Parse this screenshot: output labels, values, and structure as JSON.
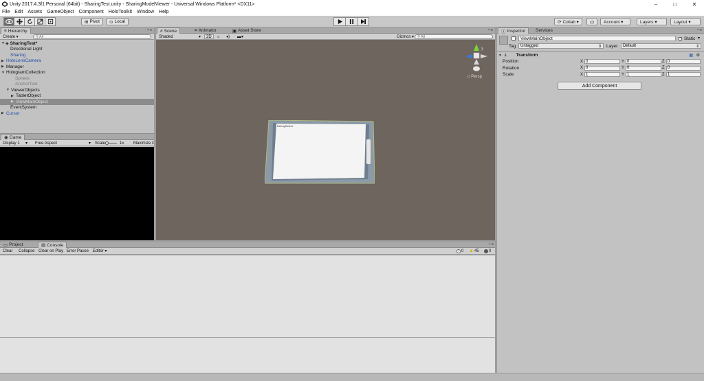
{
  "window": {
    "title": "Unity 2017.4.3f1 Personal (64bit) - SharingTest.unity - SharingModelViewer - Universal Windows Platform* <DX11>",
    "minimize": "–",
    "maximize": "□",
    "close": "✕"
  },
  "menu": [
    "File",
    "Edit",
    "Assets",
    "GameObject",
    "Component",
    "HoloToolkit",
    "Window",
    "Help"
  ],
  "toolbar": {
    "pivot": "Pivot",
    "local": "Local",
    "collab": "Collab ▾",
    "account": "Account ▾",
    "layers": "Layers ▾",
    "layout": "Layout ▾"
  },
  "hierarchy": {
    "tab": "Hierarchy",
    "create": "Create ▾",
    "search_placeholder": "All",
    "scene_name": "SharingTest*",
    "items": [
      {
        "label": "Directional Light",
        "indent": 1,
        "arrow": "",
        "style": ""
      },
      {
        "label": "Sharing",
        "indent": 1,
        "arrow": "",
        "style": "prefab"
      },
      {
        "label": "HoloLensCamera",
        "indent": 1,
        "arrow": "▶",
        "style": "prefab"
      },
      {
        "label": "Manager",
        "indent": 1,
        "arrow": "▶",
        "style": ""
      },
      {
        "label": "HologramCollection",
        "indent": 1,
        "arrow": "▼",
        "style": ""
      },
      {
        "label": "Sphere",
        "indent": 2,
        "arrow": "",
        "style": "inactive"
      },
      {
        "label": "AnchorText",
        "indent": 2,
        "arrow": "",
        "style": "inactive"
      },
      {
        "label": "ViewerObjects",
        "indent": 2,
        "arrow": "▼",
        "style": ""
      },
      {
        "label": "TabletObject",
        "indent": 3,
        "arrow": "▶",
        "style": ""
      },
      {
        "label": "ViewMainObject",
        "indent": 3,
        "arrow": "▶",
        "style": "selected"
      },
      {
        "label": "EventSystem",
        "indent": 1,
        "arrow": "",
        "style": ""
      },
      {
        "label": "Cursor",
        "indent": 1,
        "arrow": "▶",
        "style": "prefab"
      }
    ]
  },
  "scene": {
    "tabs": [
      "Scene",
      "Animator",
      "Asset Store"
    ],
    "shading": "Shaded",
    "mode_2d": "2D",
    "gizmos": "Gizmos ▾",
    "search_placeholder": "All",
    "persp": "◁ Persp",
    "tablet_text": "DebugSelect"
  },
  "game": {
    "tab": "Game",
    "display": "Display 1",
    "aspect": "Free Aspect",
    "scale_label": "Scale",
    "scale_value": "1x",
    "maximize": "Maximize C"
  },
  "bottom": {
    "tabs": [
      "Project",
      "Console"
    ],
    "buttons": [
      "Clear",
      "Collapse",
      "Clear on Play",
      "Error Pause",
      "Editor ▾"
    ],
    "counts": {
      "info": "0",
      "warn": "45",
      "error": "0"
    }
  },
  "inspector": {
    "tabs": [
      "Inspector",
      "Services"
    ],
    "object_name": "ViewMainObject",
    "static_label": "Static",
    "tag_label": "Tag",
    "tag_value": "Untagged",
    "layer_label": "Layer",
    "layer_value": "Default",
    "transform_title": "Transform",
    "rows": [
      {
        "label": "Position",
        "x": "0",
        "y": "0",
        "z": "0"
      },
      {
        "label": "Rotation",
        "x": "0",
        "y": "0",
        "z": "0"
      },
      {
        "label": "Scale",
        "x": "1",
        "y": "1",
        "z": "1"
      }
    ],
    "axis_labels": [
      "X",
      "Y",
      "Z"
    ],
    "add_component": "Add Component"
  },
  "colors": {
    "scene_bg": "#6e655e",
    "panel_bg": "#c2c2c2",
    "selection": "#8c8c8c",
    "prefab_text": "#1e4ca8"
  }
}
